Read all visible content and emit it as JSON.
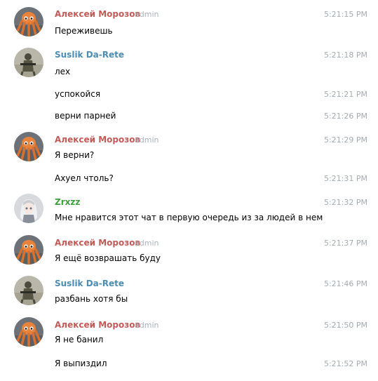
{
  "colors": {
    "aleksey": "#c25b58",
    "suslik": "#4d8cb3",
    "zrxzz": "#3f9f3f",
    "admin_badge": "#aab2b9",
    "timestamp": "#a4acb3"
  },
  "messages": [
    {
      "author": "Алексей Морозов",
      "badge": "admin",
      "text": "Переживешь",
      "time": "5:21:15 PM",
      "avatar": "octopus-icon"
    },
    {
      "author": "Suslik Da-Rete",
      "text": "лех",
      "time": "5:21:18 PM",
      "avatar": "soldier-icon"
    },
    {
      "text": "успокойся",
      "time": "5:21:21 PM"
    },
    {
      "text": "верни парней",
      "time": "5:21:26 PM"
    },
    {
      "author": "Алексей Морозов",
      "badge": "admin",
      "text": "Я верни?",
      "time": "5:21:29 PM",
      "avatar": "octopus-icon"
    },
    {
      "text": "Ахуел чтоль?",
      "time": "5:21:31 PM"
    },
    {
      "author": "Zrxzz",
      "text": "Мне нравится этот чат в первую очередь из за людей в нем",
      "time": "5:21:32 PM",
      "avatar": "anime-girl-icon"
    },
    {
      "author": "Алексей Морозов",
      "badge": "admin",
      "text": "Я ещё возврашать буду",
      "time": "5:21:37 PM",
      "avatar": "octopus-icon"
    },
    {
      "author": "Suslik Da-Rete",
      "text": "разбань хотя бы",
      "time": "5:21:46 PM",
      "avatar": "soldier-icon"
    },
    {
      "author": "Алексей Морозов",
      "badge": "admin",
      "text": "Я не банил",
      "time": "5:21:50 PM",
      "avatar": "octopus-icon"
    },
    {
      "text": "Я выпиздил",
      "time": "5:21:52 PM"
    }
  ]
}
